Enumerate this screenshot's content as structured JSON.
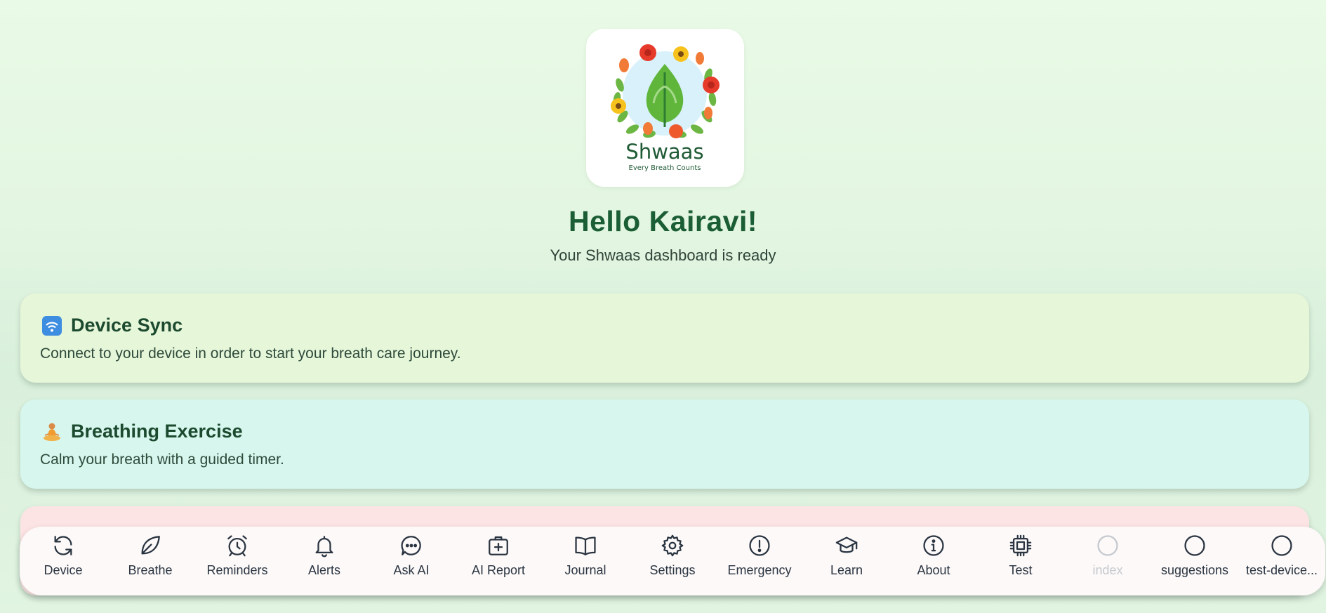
{
  "logo": {
    "brand": "Shwaas",
    "tagline": "Every Breath Counts"
  },
  "header": {
    "greeting": "Hello Kairavi!",
    "subtitle": "Your Shwaas dashboard is ready"
  },
  "cards": [
    {
      "emoji": "wifi-signal-icon",
      "title": "Device Sync",
      "description": "Connect to your device in order to start your breath care journey.",
      "color": "#e6f6d9"
    },
    {
      "emoji": "meditation-icon",
      "title": "Breathing Exercise",
      "description": "Calm your breath with a guided timer.",
      "color": "#d7f7ee"
    },
    {
      "color": "#fde4e4"
    }
  ],
  "nav": {
    "items": [
      {
        "label": "Device",
        "icon": "sync-icon"
      },
      {
        "label": "Breathe",
        "icon": "leaf-icon"
      },
      {
        "label": "Reminders",
        "icon": "alarm-clock-icon"
      },
      {
        "label": "Alerts",
        "icon": "bell-icon"
      },
      {
        "label": "Ask AI",
        "icon": "chat-bubble-icon"
      },
      {
        "label": "AI Report",
        "icon": "medical-kit-icon"
      },
      {
        "label": "Journal",
        "icon": "book-icon"
      },
      {
        "label": "Settings",
        "icon": "gear-icon"
      },
      {
        "label": "Emergency",
        "icon": "alert-circle-icon"
      },
      {
        "label": "Learn",
        "icon": "graduation-cap-icon"
      },
      {
        "label": "About",
        "icon": "info-icon"
      },
      {
        "label": "Test",
        "icon": "chip-icon"
      },
      {
        "label": "index",
        "icon": "circle-icon",
        "disabled": true
      },
      {
        "label": "suggestions",
        "icon": "circle-icon"
      },
      {
        "label": "test-device...",
        "icon": "circle-icon"
      }
    ]
  },
  "colors": {
    "accent": "#1b5e35",
    "nav_text": "#2b3542",
    "nav_disabled": "#c5c9cf"
  }
}
